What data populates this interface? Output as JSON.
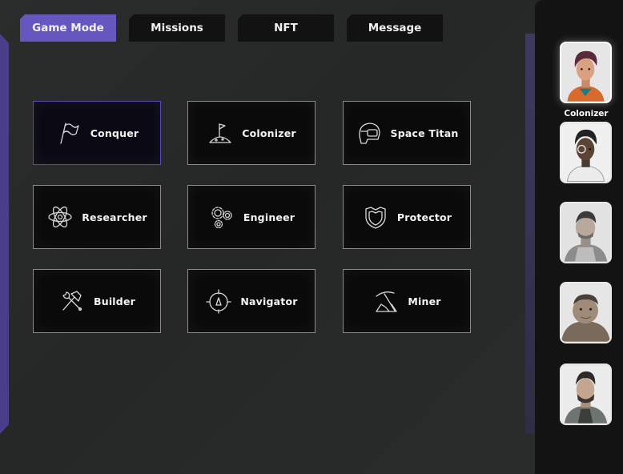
{
  "tabs": [
    {
      "label": "Game Mode",
      "active": true
    },
    {
      "label": "Missions",
      "active": false
    },
    {
      "label": "NFT",
      "active": false
    },
    {
      "label": "Message",
      "active": false
    }
  ],
  "modes": [
    {
      "label": "Conquer",
      "icon": "flag-icon",
      "selected": true
    },
    {
      "label": "Colonizer",
      "icon": "planet-flag-icon",
      "selected": false
    },
    {
      "label": "Space Titan",
      "icon": "helmet-icon",
      "selected": false
    },
    {
      "label": "Researcher",
      "icon": "atom-icon",
      "selected": false
    },
    {
      "label": "Engineer",
      "icon": "gears-icon",
      "selected": false
    },
    {
      "label": "Protector",
      "icon": "shield-icon",
      "selected": false
    },
    {
      "label": "Builder",
      "icon": "hammer-wrench-icon",
      "selected": false
    },
    {
      "label": "Navigator",
      "icon": "compass-icon",
      "selected": false
    },
    {
      "label": "Miner",
      "icon": "pickaxe-icon",
      "selected": false
    }
  ],
  "characters": {
    "selected_caption": "Colonizer"
  },
  "colors": {
    "accent": "#6657c0",
    "selected_border": "#5449c0",
    "card_border": "#8a8a8a",
    "sidebar_bg": "#131313"
  }
}
